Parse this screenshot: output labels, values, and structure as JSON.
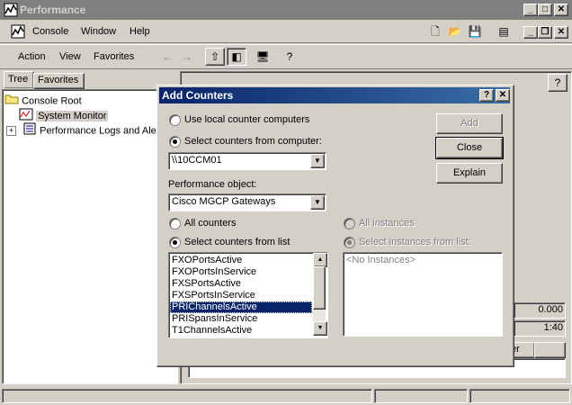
{
  "window": {
    "title": "Performance"
  },
  "menubar": {
    "console": "Console",
    "window": "Window",
    "help": "Help"
  },
  "actionbar": {
    "action": "Action",
    "view": "View",
    "favorites": "Favorites"
  },
  "tabs": {
    "tree": "Tree",
    "favorites": "Favorites"
  },
  "tree": {
    "root": "Console Root",
    "system_monitor": "System Monitor",
    "perf_logs": "Performance Logs and Alerts"
  },
  "bg_panel": {
    "value1": "0.000",
    "value2": "1:40",
    "col_header": "er"
  },
  "dialog": {
    "title": "Add Counters",
    "radio_local": "Use local counter computers",
    "radio_select_computer": "Select counters from computer:",
    "computer_value": "\\\\10CCM01",
    "perf_object_label": "Performance object:",
    "perf_object_value": "Cisco MGCP Gateways",
    "radio_all_counters": "All counters",
    "radio_select_counters": "Select counters from list",
    "radio_all_instances": "All instances",
    "radio_select_instances": "Select instances from list:",
    "counters": [
      "FXOPortsActive",
      "FXOPortsInService",
      "FXSPortsActive",
      "FXSPortsInService",
      "PRIChannelsActive",
      "PRISpansInService",
      "T1ChannelsActive"
    ],
    "instances_placeholder": "<No Instances>",
    "add_button": "Add",
    "close_button": "Close",
    "explain_button": "Explain"
  }
}
